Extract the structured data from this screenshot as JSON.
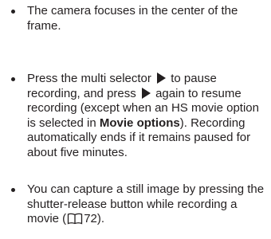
{
  "bullets": [
    {
      "text": "The camera focuses in the center of the frame."
    },
    {
      "part1": "Press the multi selector",
      "part2": "to pause recording, and press",
      "part3": "again to resume recording (except when an HS movie option is selected in",
      "bold": "Movie options",
      "part4": "). Recording automatically ends if it remains paused for about five minutes."
    },
    {
      "part1": "You can capture a still image by pressing the shutter-release button while recording a movie (",
      "page_ref": "72",
      "part2": ")."
    }
  ],
  "icons": {
    "multi_selector_right": "triangle-right-icon",
    "page_reference": "book-icon"
  },
  "colors": {
    "text": "#231f20"
  }
}
